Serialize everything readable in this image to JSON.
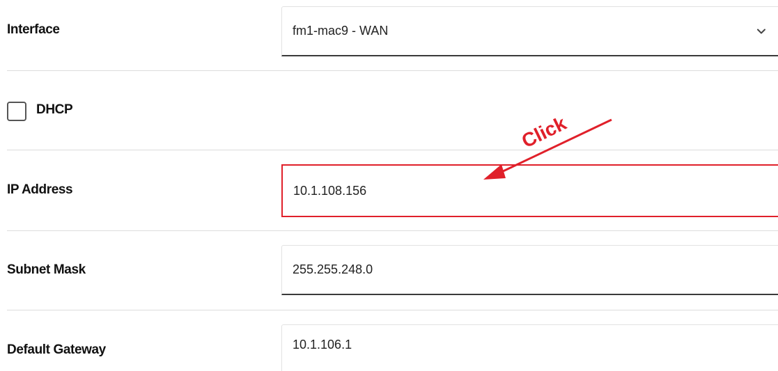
{
  "interface": {
    "label": "Interface",
    "value": "fm1-mac9 - WAN"
  },
  "dhcp": {
    "label": "DHCP",
    "checked": false
  },
  "ip_address": {
    "label": "IP Address",
    "value": "10.1.108.156"
  },
  "subnet_mask": {
    "label": "Subnet Mask",
    "value": "255.255.248.0"
  },
  "default_gateway": {
    "label": "Default Gateway",
    "value": "10.1.106.1"
  },
  "annotation": {
    "text": "Click",
    "color": "#e0202a"
  },
  "icons": {
    "dropdown": "chevron-down-icon"
  }
}
